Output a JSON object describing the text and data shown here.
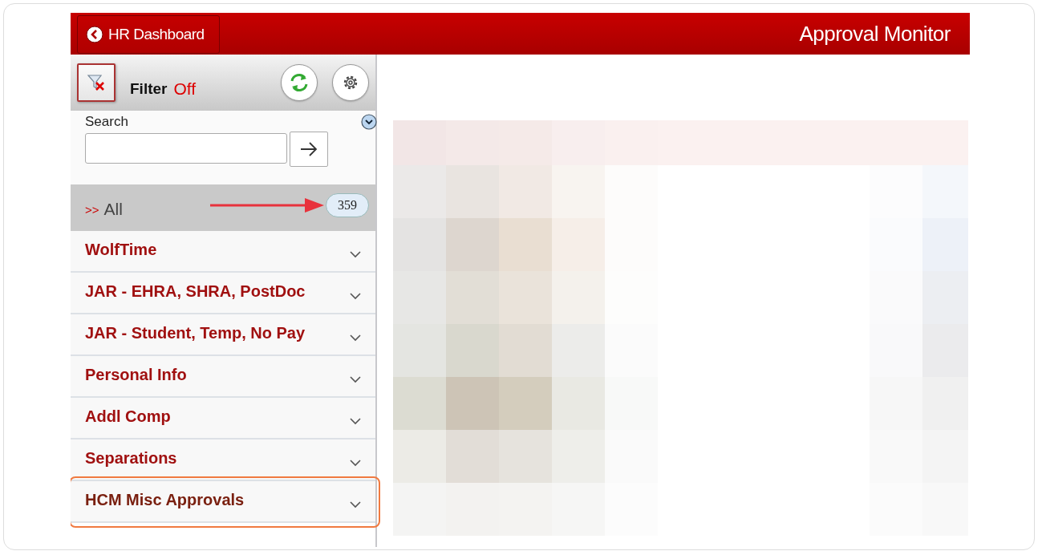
{
  "header": {
    "back_button": "HR Dashboard",
    "title": "Approval Monitor"
  },
  "toolbar": {
    "filter_label": "Filter",
    "filter_state": "Off"
  },
  "search": {
    "label": "Search"
  },
  "all_row": {
    "marker": ">>",
    "label": "All",
    "count": "359"
  },
  "categories": [
    {
      "label": "WolfTime",
      "expanded": false,
      "highlighted": false
    },
    {
      "label": "JAR - EHRA, SHRA, PostDoc",
      "expanded": false,
      "highlighted": false
    },
    {
      "label": "JAR - Student, Temp, No Pay",
      "expanded": false,
      "highlighted": false
    },
    {
      "label": "Personal Info",
      "expanded": false,
      "highlighted": false
    },
    {
      "label": "Addl Comp",
      "expanded": false,
      "highlighted": false
    },
    {
      "label": "Separations",
      "expanded": false,
      "highlighted": false
    },
    {
      "label": "HCM Misc Approvals",
      "expanded": false,
      "highlighted": true
    }
  ]
}
